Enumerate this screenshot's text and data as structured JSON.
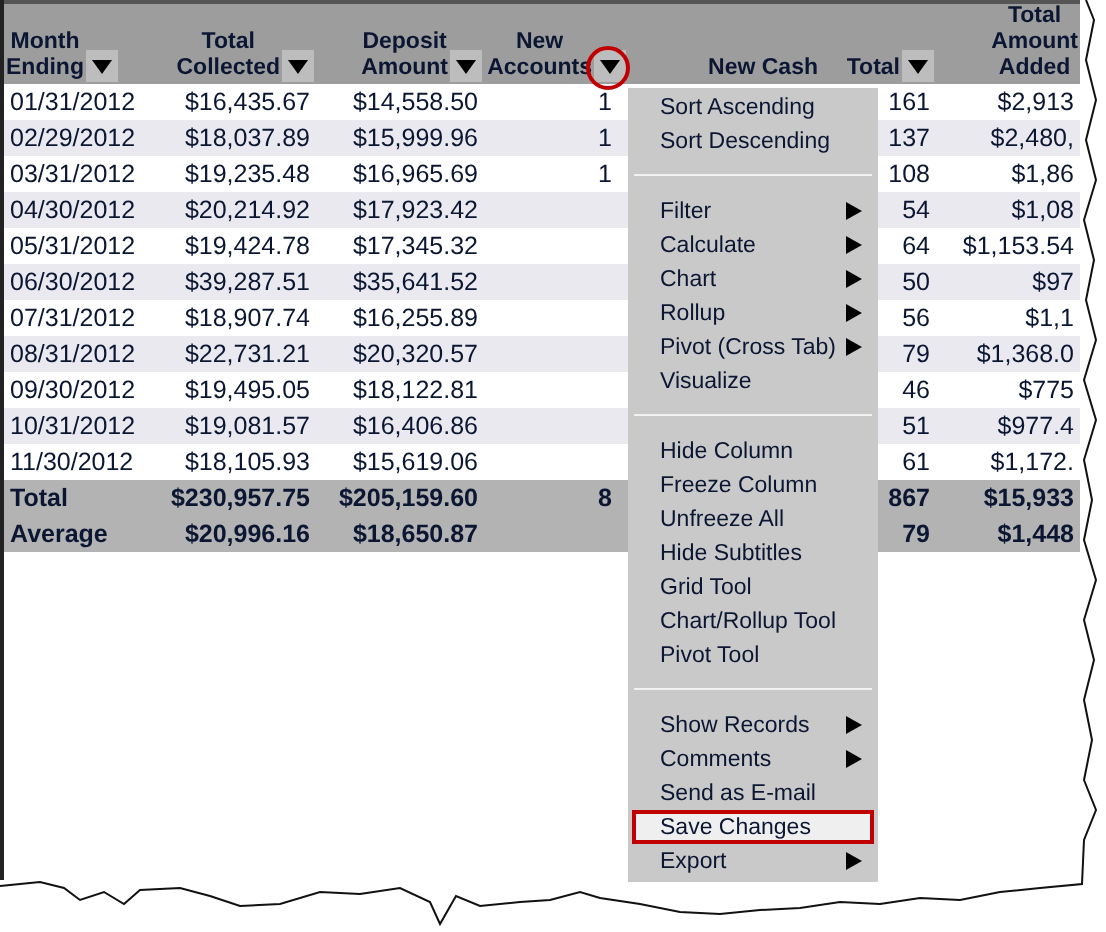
{
  "table": {
    "columns": [
      {
        "label": "Month\nEnding",
        "filter": true,
        "highlighted": false
      },
      {
        "label": "Total\nCollected",
        "filter": true,
        "highlighted": false
      },
      {
        "label": "Deposit\nAmount",
        "filter": true,
        "highlighted": false
      },
      {
        "label": "New\nAccounts",
        "filter": true,
        "highlighted": true
      },
      {
        "label": "New Cash",
        "filter": false,
        "highlighted": false
      },
      {
        "label": "Total",
        "filter": true,
        "highlighted": false
      },
      {
        "label": "Total\nAmount\nAdded",
        "filter": false,
        "highlighted": false
      }
    ],
    "rows": [
      [
        "01/31/2012",
        "$16,435.67",
        "$14,558.50",
        "1",
        null,
        "161",
        "$2,913"
      ],
      [
        "02/29/2012",
        "$18,037.89",
        "$15,999.96",
        "1",
        null,
        "137",
        "$2,480,"
      ],
      [
        "03/31/2012",
        "$19,235.48",
        "$16,965.69",
        "1",
        null,
        "108",
        "$1,86"
      ],
      [
        "04/30/2012",
        "$20,214.92",
        "$17,923.42",
        null,
        null,
        "54",
        "$1,08"
      ],
      [
        "05/31/2012",
        "$19,424.78",
        "$17,345.32",
        null,
        null,
        "64",
        "$1,153.54"
      ],
      [
        "06/30/2012",
        "$39,287.51",
        "$35,641.52",
        null,
        null,
        "50",
        "$97"
      ],
      [
        "07/31/2012",
        "$18,907.74",
        "$16,255.89",
        null,
        null,
        "56",
        "$1,1"
      ],
      [
        "08/31/2012",
        "$22,731.21",
        "$20,320.57",
        null,
        null,
        "79",
        "$1,368.0"
      ],
      [
        "09/30/2012",
        "$19,495.05",
        "$18,122.81",
        null,
        null,
        "46",
        "$775"
      ],
      [
        "10/31/2012",
        "$19,081.57",
        "$16,406.86",
        null,
        null,
        "51",
        "$977.4"
      ],
      [
        "11/30/2012",
        "$18,105.93",
        "$15,619.06",
        null,
        null,
        "61",
        "$1,172."
      ]
    ],
    "summary_rows": [
      [
        "Total",
        "$230,957.75",
        "$205,159.60",
        "8",
        null,
        "867",
        "$15,933"
      ],
      [
        "Average",
        "$20,996.16",
        "$18,650.87",
        null,
        null,
        "79",
        "$1,448"
      ]
    ]
  },
  "menu": {
    "items": [
      {
        "kind": "item",
        "label": "Sort Ascending",
        "submenu": false,
        "selected": false
      },
      {
        "kind": "item",
        "label": "Sort Descending",
        "submenu": false,
        "selected": false
      },
      {
        "kind": "separator"
      },
      {
        "kind": "item",
        "label": "Filter",
        "submenu": true,
        "selected": false
      },
      {
        "kind": "item",
        "label": "Calculate",
        "submenu": true,
        "selected": false
      },
      {
        "kind": "item",
        "label": "Chart",
        "submenu": true,
        "selected": false
      },
      {
        "kind": "item",
        "label": "Rollup",
        "submenu": true,
        "selected": false
      },
      {
        "kind": "item",
        "label": "Pivot (Cross Tab)",
        "submenu": true,
        "selected": false
      },
      {
        "kind": "item",
        "label": "Visualize",
        "submenu": false,
        "selected": false
      },
      {
        "kind": "separator"
      },
      {
        "kind": "item",
        "label": "Hide Column",
        "submenu": false,
        "selected": false
      },
      {
        "kind": "item",
        "label": "Freeze Column",
        "submenu": false,
        "selected": false
      },
      {
        "kind": "item",
        "label": "Unfreeze All",
        "submenu": false,
        "selected": false
      },
      {
        "kind": "item",
        "label": "Hide Subtitles",
        "submenu": false,
        "selected": false
      },
      {
        "kind": "item",
        "label": "Grid Tool",
        "submenu": false,
        "selected": false
      },
      {
        "kind": "item",
        "label": "Chart/Rollup Tool",
        "submenu": false,
        "selected": false
      },
      {
        "kind": "item",
        "label": "Pivot Tool",
        "submenu": false,
        "selected": false
      },
      {
        "kind": "separator"
      },
      {
        "kind": "item",
        "label": "Show Records",
        "submenu": true,
        "selected": false
      },
      {
        "kind": "item",
        "label": "Comments",
        "submenu": true,
        "selected": false
      },
      {
        "kind": "item",
        "label": "Send as E-mail",
        "submenu": false,
        "selected": false
      },
      {
        "kind": "item",
        "label": "Save Changes",
        "submenu": false,
        "selected": true
      },
      {
        "kind": "item",
        "label": "Export",
        "submenu": true,
        "selected": false
      }
    ]
  }
}
